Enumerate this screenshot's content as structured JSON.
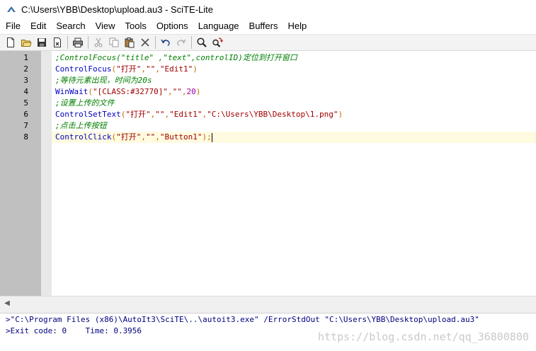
{
  "window": {
    "title": "C:\\Users\\YBB\\Desktop\\upload.au3 - SciTE-Lite"
  },
  "menu": [
    "File",
    "Edit",
    "Search",
    "View",
    "Tools",
    "Options",
    "Language",
    "Buffers",
    "Help"
  ],
  "editor": {
    "line_numbers": [
      "1",
      "2",
      "3",
      "4",
      "5",
      "6",
      "7",
      "8"
    ],
    "lines": [
      [
        {
          "cls": "c-comment",
          "text": ";ControlFocus(\"title\" ,\"text\",controlID)定位到打开窗口"
        }
      ],
      [
        {
          "cls": "c-func",
          "text": "ControlFocus"
        },
        {
          "cls": "c-paren",
          "text": "("
        },
        {
          "cls": "c-str",
          "text": "\"打开\""
        },
        {
          "cls": "c-paren",
          "text": ","
        },
        {
          "cls": "c-str",
          "text": "\"\""
        },
        {
          "cls": "c-paren",
          "text": ","
        },
        {
          "cls": "c-str",
          "text": "\"Edit1\""
        },
        {
          "cls": "c-paren",
          "text": ")"
        }
      ],
      [
        {
          "cls": "c-comment",
          "text": ";等待元素出现，时间为20s"
        }
      ],
      [
        {
          "cls": "c-func",
          "text": "WinWait"
        },
        {
          "cls": "c-paren",
          "text": "("
        },
        {
          "cls": "c-str",
          "text": "\"[CLASS:#32770]\""
        },
        {
          "cls": "c-paren",
          "text": ","
        },
        {
          "cls": "c-str",
          "text": "\"\""
        },
        {
          "cls": "c-paren",
          "text": ","
        },
        {
          "cls": "c-num",
          "text": "20"
        },
        {
          "cls": "c-paren",
          "text": ")"
        }
      ],
      [
        {
          "cls": "c-comment",
          "text": ";设置上传的文件"
        }
      ],
      [
        {
          "cls": "c-func",
          "text": "ControlSetText"
        },
        {
          "cls": "c-paren",
          "text": "("
        },
        {
          "cls": "c-str",
          "text": "\"打开\""
        },
        {
          "cls": "c-paren",
          "text": ","
        },
        {
          "cls": "c-str",
          "text": "\"\""
        },
        {
          "cls": "c-paren",
          "text": ","
        },
        {
          "cls": "c-str",
          "text": "\"Edit1\""
        },
        {
          "cls": "c-paren",
          "text": ","
        },
        {
          "cls": "c-str",
          "text": "\"C:\\Users\\YBB\\Desktop\\1.png\""
        },
        {
          "cls": "c-paren",
          "text": ")"
        }
      ],
      [
        {
          "cls": "c-comment",
          "text": ";点击上传按钮"
        }
      ],
      [
        {
          "cls": "c-func",
          "text": "ControlClick"
        },
        {
          "cls": "c-paren",
          "text": "("
        },
        {
          "cls": "c-str",
          "text": "\"打开\""
        },
        {
          "cls": "c-paren",
          "text": ","
        },
        {
          "cls": "c-str",
          "text": "\"\""
        },
        {
          "cls": "c-paren",
          "text": ","
        },
        {
          "cls": "c-str",
          "text": "\"Button1\""
        },
        {
          "cls": "c-paren",
          "text": ");"
        }
      ]
    ]
  },
  "output": {
    "lines": [
      ">\"C:\\Program Files (x86)\\AutoIt3\\SciTE\\..\\autoit3.exe\" /ErrorStdOut \"C:\\Users\\YBB\\Desktop\\upload.au3\"",
      ">Exit code: 0    Time: 0.3956"
    ],
    "watermark": "https://blog.csdn.net/qq_36800800"
  }
}
